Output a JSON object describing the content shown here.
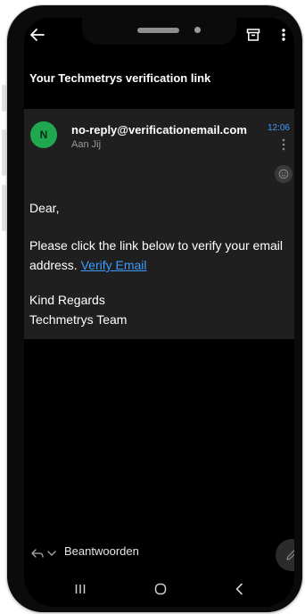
{
  "email": {
    "subject": "Your Techmetrys verification link",
    "sender": "no-reply@verificationemail.com",
    "recipient": "Aan Jij",
    "avatar_letter": "N",
    "time": "12:06",
    "greeting": "Dear,",
    "body_text": "Please click the link below to verify your email address.",
    "link_text": "Verify Email",
    "signoff_line1": "Kind Regards",
    "signoff_line2": "Techmetrys Team"
  },
  "reply": {
    "label": "Beantwoorden"
  },
  "icons": {
    "back": "arrow-left-icon",
    "archive": "archive-icon",
    "more": "more-vert-icon",
    "emoji": "add-emoji-icon",
    "reply": "reply-icon",
    "compose": "pencil-icon",
    "nav_recents": "recents-icon",
    "nav_home": "home-icon",
    "nav_back": "nav-back-icon"
  },
  "colors": {
    "avatar": "#1fa84f",
    "link": "#3b9cff",
    "card": "#1f1f1f",
    "background": "#000000"
  }
}
